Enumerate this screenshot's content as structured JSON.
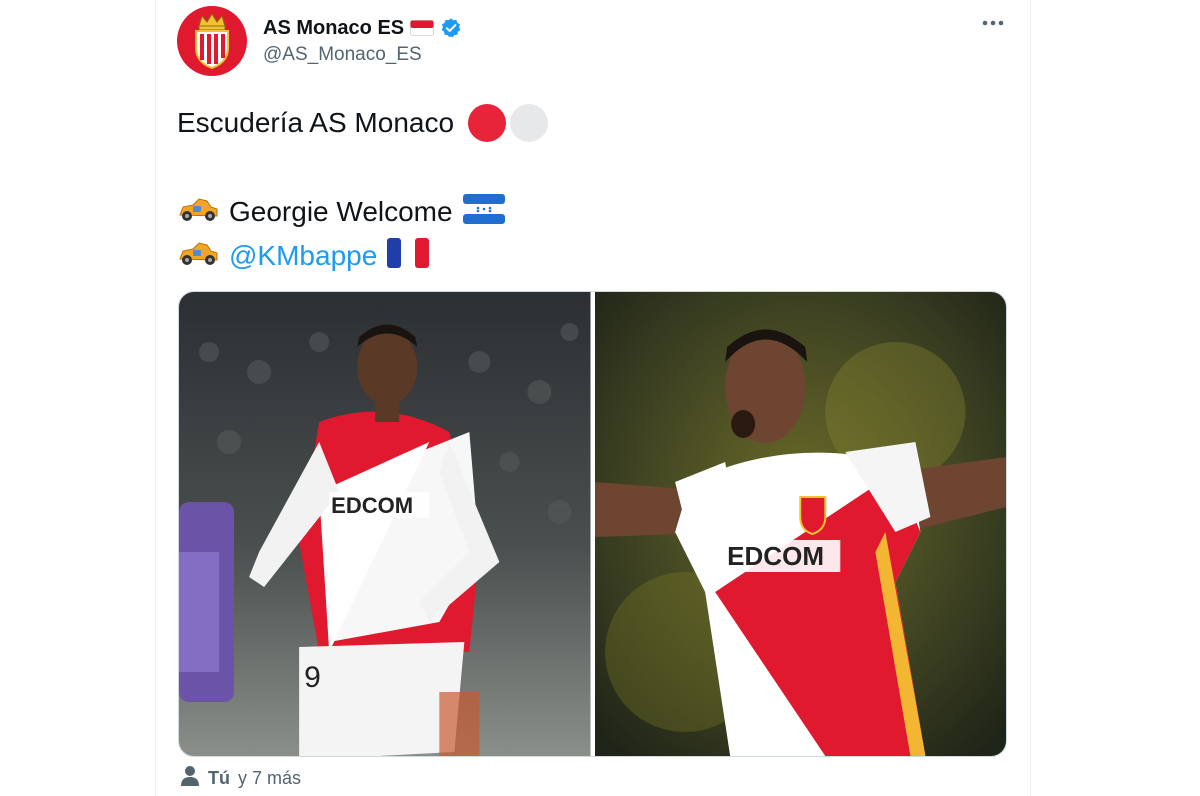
{
  "tweet": {
    "display_name": "AS Monaco ES",
    "handle": "@AS_Monaco_ES",
    "verified_icon": "verified-badge-icon",
    "flag_icon": "monaco-flag-icon",
    "more_icon": "more-options-icon",
    "line1_text": "Escudería AS Monaco",
    "line2_text": "Georgie Welcome",
    "line3_mention": "@KMbappe",
    "line_icon": "racing-car-icon",
    "tagged_user": "Tú",
    "tagged_rest": "y 7 más",
    "colors": {
      "accent_red": "#e0192f",
      "link_blue": "#1d9bf0",
      "verified_blue": "#1d9bf0",
      "muted_text": "#536471",
      "red_circle": "#e8243b",
      "white_circle": "#e6e8ea"
    }
  }
}
